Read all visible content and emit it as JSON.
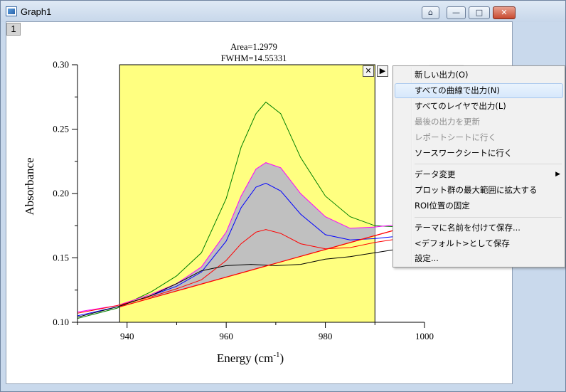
{
  "window": {
    "title": "Graph1",
    "layer_label": "1",
    "buttons": [
      "home",
      "minimize",
      "maximize",
      "close"
    ]
  },
  "annotation": {
    "area": "Area=1.2979",
    "fwhm": "FWHM=14.55331"
  },
  "plot": {
    "ylabel": "Absorbance",
    "xlabel": "Energy (cm",
    "xlabel_sup": "-1",
    "xlabel_end": ")",
    "xticks": [
      "940",
      "960",
      "980",
      "1000"
    ],
    "yticks": [
      "0.10",
      "0.15",
      "0.20",
      "0.25",
      "0.30"
    ],
    "roi_color": "#ffff80",
    "fill_color": "#c0c0c0"
  },
  "chart_data": {
    "type": "line",
    "xlabel": "Energy (cm-1)",
    "ylabel": "Absorbance",
    "xlim": [
      930,
      1000
    ],
    "ylim": [
      0.1,
      0.3
    ],
    "roi": [
      938.5,
      990
    ],
    "series": [
      {
        "color": "#008000",
        "x": [
          930,
          938,
          945,
          950,
          955,
          960,
          963,
          966,
          968,
          971,
          975,
          980,
          985,
          990,
          995,
          1000
        ],
        "y": [
          0.103,
          0.111,
          0.124,
          0.136,
          0.154,
          0.196,
          0.236,
          0.262,
          0.271,
          0.262,
          0.228,
          0.198,
          0.182,
          0.175,
          0.174,
          0.176
        ]
      },
      {
        "color": "#ff00ff",
        "x": [
          930,
          938,
          945,
          950,
          955,
          960,
          963,
          966,
          968,
          971,
          975,
          980,
          985,
          990,
          995,
          1000
        ],
        "y": [
          0.108,
          0.113,
          0.122,
          0.13,
          0.143,
          0.17,
          0.198,
          0.219,
          0.224,
          0.22,
          0.2,
          0.182,
          0.173,
          0.174,
          0.176,
          0.178
        ]
      },
      {
        "color": "#0000ff",
        "x": [
          930,
          938,
          945,
          950,
          955,
          960,
          963,
          966,
          968,
          971,
          975,
          980,
          985,
          990,
          995,
          1000
        ],
        "y": [
          0.105,
          0.112,
          0.121,
          0.128,
          0.139,
          0.163,
          0.189,
          0.205,
          0.208,
          0.202,
          0.184,
          0.168,
          0.164,
          0.165,
          0.167,
          0.17
        ]
      },
      {
        "color": "#ff0000",
        "x": [
          930,
          938,
          945,
          950,
          955,
          960,
          963,
          966,
          968,
          971,
          975,
          980,
          985,
          990,
          995,
          1000
        ],
        "y": [
          0.107,
          0.113,
          0.12,
          0.126,
          0.133,
          0.148,
          0.161,
          0.17,
          0.172,
          0.169,
          0.161,
          0.157,
          0.158,
          0.162,
          0.165,
          0.168
        ]
      },
      {
        "color": "#000000",
        "x": [
          930,
          938,
          945,
          950,
          955,
          960,
          965,
          970,
          975,
          980,
          985,
          990,
          995,
          1000
        ],
        "y": [
          0.104,
          0.112,
          0.121,
          0.13,
          0.14,
          0.144,
          0.145,
          0.144,
          0.145,
          0.149,
          0.151,
          0.154,
          0.157,
          0.16
        ]
      },
      {
        "color": "#ff0000",
        "x": [
          938.5,
          1000
        ],
        "y": [
          0.112,
          0.178
        ]
      }
    ]
  },
  "context_menu": {
    "items": [
      {
        "label": "新しい出力(O)",
        "state": "normal"
      },
      {
        "label": "すべての曲線で出力(N)",
        "state": "highlighted"
      },
      {
        "label": "すべてのレイヤで出力(L)",
        "state": "normal"
      },
      {
        "label": "最後の出力を更新",
        "state": "disabled"
      },
      {
        "label": "レポートシートに行く",
        "state": "disabled"
      },
      {
        "label": "ソースワークシートに行く",
        "state": "normal"
      },
      {
        "label": "データ変更",
        "state": "submenu"
      },
      {
        "label": "プロット群の最大範囲に拡大する",
        "state": "normal"
      },
      {
        "label": "ROI位置の固定",
        "state": "normal"
      },
      {
        "label": "テーマに名前を付けて保存...",
        "state": "normal"
      },
      {
        "label": "<デフォルト>として保存",
        "state": "normal"
      },
      {
        "label": "設定...",
        "state": "normal"
      }
    ]
  }
}
